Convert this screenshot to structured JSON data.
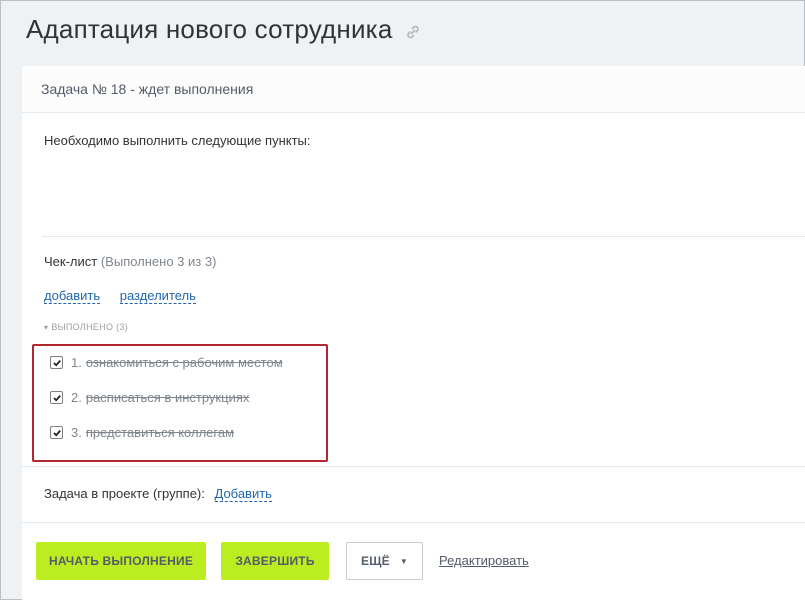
{
  "page": {
    "title": "Адаптация нового сотрудника",
    "link_icon": "link-icon"
  },
  "task": {
    "header": "Задача № 18 - ждет выполнения",
    "description": "Необходимо выполнить следующие пункты:"
  },
  "checklist": {
    "title": "Чек-лист",
    "progress": "(Выполнено 3 из 3)",
    "add_link": "добавить",
    "separator_link": "разделитель",
    "done_label": "выполнено",
    "done_count": "(3)",
    "items": [
      {
        "number": "1.",
        "text": "ознакомиться с рабочим местом",
        "checked": true
      },
      {
        "number": "2.",
        "text": "расписаться в инструкциях",
        "checked": true
      },
      {
        "number": "3.",
        "text": "представиться коллегам",
        "checked": true
      }
    ]
  },
  "project": {
    "label": "Задача в проекте (группе):",
    "add_link": "Добавить"
  },
  "buttons": {
    "start": "Начать выполнение",
    "finish": "Завершить",
    "more": "Ещё",
    "edit": "Редактировать"
  },
  "colors": {
    "accent_green": "#bbed21",
    "link_blue": "#2067b0",
    "highlight_red": "#b2262e"
  }
}
